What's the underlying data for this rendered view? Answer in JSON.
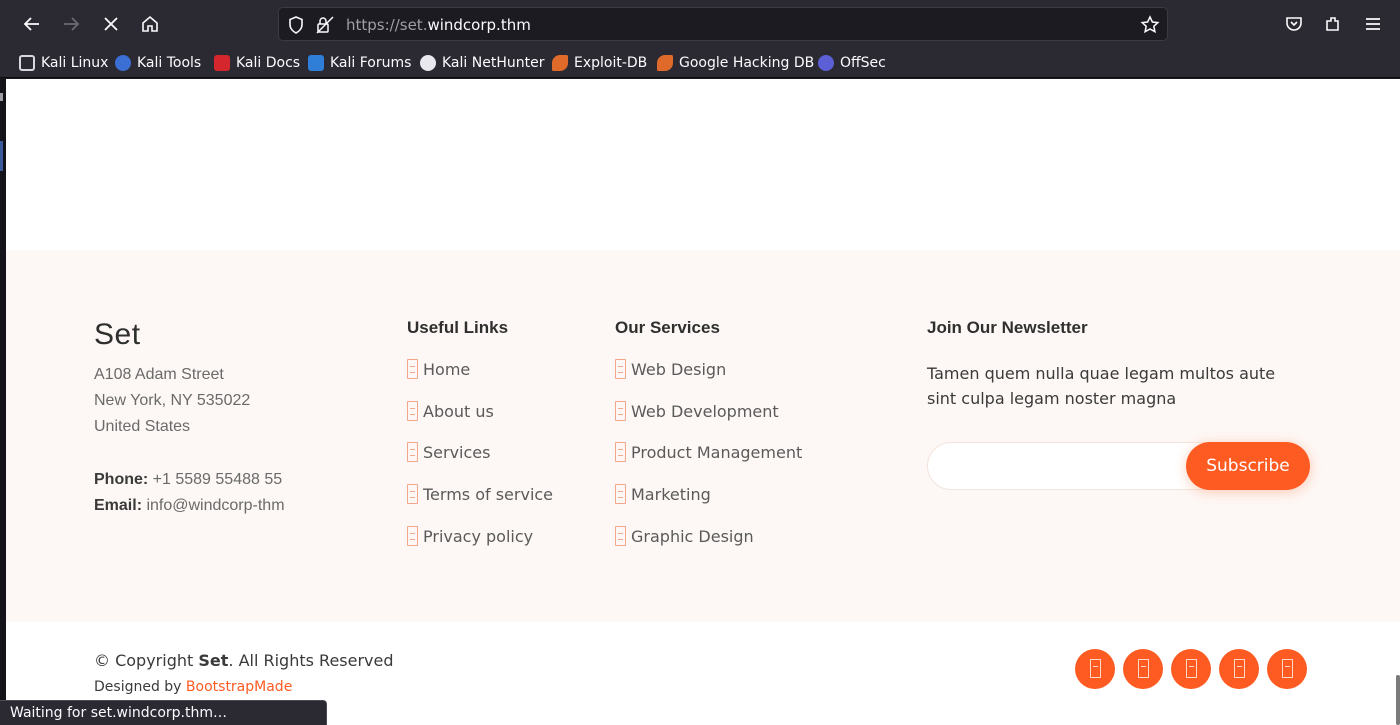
{
  "browser": {
    "url_prefix": "https://set.",
    "url_host": "windcorp.thm",
    "bookmarks": [
      "Kali Linux",
      "Kali Tools",
      "Kali Docs",
      "Kali Forums",
      "Kali NetHunter",
      "Exploit-DB",
      "Google Hacking DB",
      "OffSec"
    ],
    "status_text": "Waiting for set.windcorp.thm…"
  },
  "footer": {
    "brand": "Set",
    "address_line1": "A108 Adam Street",
    "address_line2": "New York, NY 535022",
    "address_line3": "United States",
    "phone_label": "Phone:",
    "phone_value": " +1 5589 55488 55",
    "email_label": "Email:",
    "email_value": " info@windcorp-thm",
    "useful_links_title": "Useful Links",
    "useful_links": [
      "Home",
      "About us",
      "Services",
      "Terms of service",
      "Privacy policy"
    ],
    "services_title": "Our Services",
    "services": [
      "Web Design",
      "Web Development",
      "Product Management",
      "Marketing",
      "Graphic Design"
    ],
    "newsletter_title": "Join Our Newsletter",
    "newsletter_text": "Tamen quem nulla quae legam multos aute sint culpa legam noster magna",
    "subscribe_label": "Subscribe",
    "email_input_value": ""
  },
  "copyright": {
    "prefix": "© Copyright ",
    "brand": "Set",
    "suffix": ". All Rights Reserved",
    "designed_by": "Designed by ",
    "designer": "BootstrapMade"
  },
  "social": [
    "twitter-icon",
    "facebook-icon",
    "instagram-icon",
    "skype-icon",
    "linkedin-icon"
  ],
  "colors": {
    "accent": "#fe5b22",
    "footer_bg": "#fdf8f5",
    "chrome_bg": "#2b2a33"
  }
}
